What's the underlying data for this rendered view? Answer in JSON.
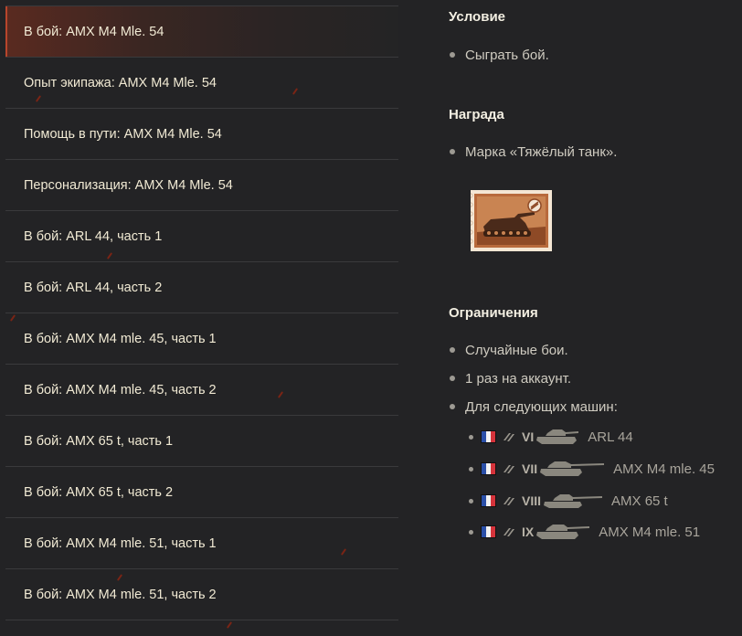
{
  "missions": [
    {
      "label": "В бой: AMX M4 Mle. 54",
      "active": true
    },
    {
      "label": "Опыт экипажа: AMX M4 Mle. 54",
      "active": false
    },
    {
      "label": "Помощь в пути: AMX M4 Mle. 54",
      "active": false
    },
    {
      "label": "Персонализация: AMX M4 Mle. 54",
      "active": false
    },
    {
      "label": "В бой: ARL 44, часть 1",
      "active": false
    },
    {
      "label": "В бой: ARL 44, часть 2",
      "active": false
    },
    {
      "label": "В бой: AMX M4 mle. 45, часть 1",
      "active": false
    },
    {
      "label": "В бой: AMX M4 mle. 45, часть 2",
      "active": false
    },
    {
      "label": "В бой: AMX 65 t, часть 1",
      "active": false
    },
    {
      "label": "В бой: AMX 65 t, часть 2",
      "active": false
    },
    {
      "label": "В бой: AMX M4 mle. 51, часть 1",
      "active": false
    },
    {
      "label": "В бой: AMX M4 mle. 51, часть 2",
      "active": false
    }
  ],
  "condition": {
    "title": "Условие",
    "items": [
      "Сыграть бой."
    ]
  },
  "reward": {
    "title": "Награда",
    "items": [
      "Марка «Тяжёлый танк»."
    ]
  },
  "restrictions": {
    "title": "Ограничения",
    "items": [
      "Случайные бои.",
      "1 раз на аккаунт.",
      "Для следующих машин:"
    ],
    "vehicles": [
      {
        "nation": "france",
        "class_icon": "heavy-tank-icon",
        "tier": "VI",
        "name": "ARL 44"
      },
      {
        "nation": "france",
        "class_icon": "heavy-tank-icon",
        "tier": "VII",
        "name": "AMX M4 mle. 45"
      },
      {
        "nation": "france",
        "class_icon": "heavy-tank-icon",
        "tier": "VIII",
        "name": "AMX 65 t"
      },
      {
        "nation": "france",
        "class_icon": "heavy-tank-icon",
        "tier": "IX",
        "name": "AMX M4 mle. 51"
      }
    ]
  },
  "colors": {
    "background": "#232325",
    "active_accent": "#b8452c",
    "text_primary": "#f1ead4",
    "text_secondary": "#cfcbc0",
    "flag_blue": "#2a4fa8",
    "flag_white": "#f2f2f2",
    "flag_red": "#d6333b"
  }
}
